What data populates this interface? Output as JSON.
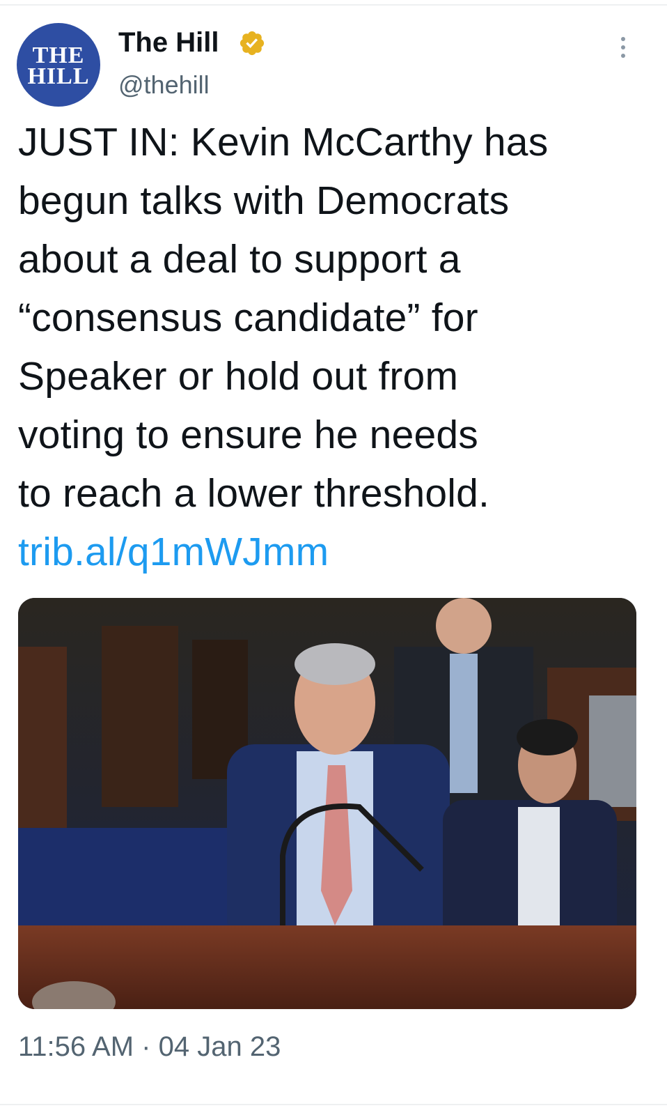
{
  "author": {
    "name": "The Hill",
    "handle": "@thehill",
    "avatar_text_line1": "THE",
    "avatar_text_line2": "HILL",
    "verified_icon": "verified-badge-icon",
    "verified_color": "#e7b220"
  },
  "tweet": {
    "lines": [
      "JUST IN: Kevin McCarthy  has",
      "begun talks with Democrats",
      "about a deal to support a",
      "“consensus candidate” for",
      "Speaker or hold out from",
      "voting to ensure he needs",
      "to reach a lower threshold."
    ],
    "link": "trib.al/q1mWJmm",
    "link_color": "#1d9bf0"
  },
  "media": {
    "alt_icon": "photo-icon"
  },
  "meta": {
    "time": "11:56 AM",
    "separator": "·",
    "date": "04 Jan 23"
  },
  "icons": {
    "more": "more-options-icon"
  }
}
